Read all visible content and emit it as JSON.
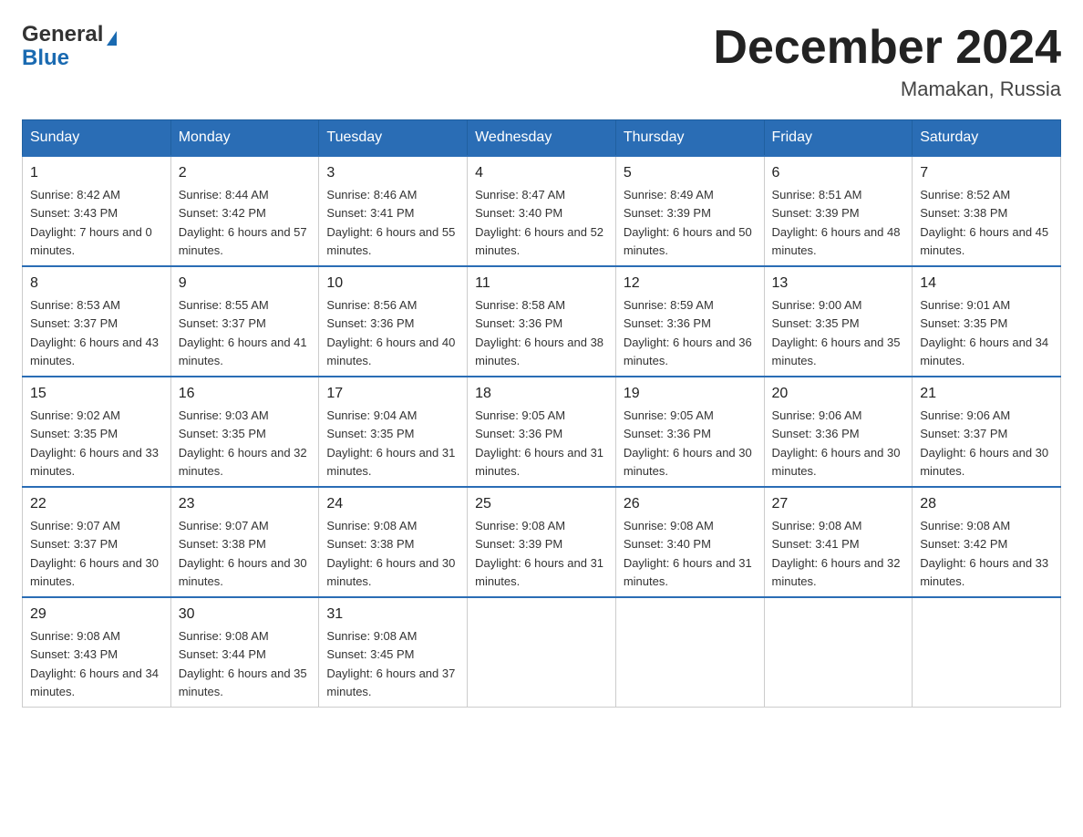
{
  "logo": {
    "general": "General",
    "blue": "Blue",
    "triangle_char": "▶"
  },
  "title": "December 2024",
  "subtitle": "Mamakan, Russia",
  "days_of_week": [
    "Sunday",
    "Monday",
    "Tuesday",
    "Wednesday",
    "Thursday",
    "Friday",
    "Saturday"
  ],
  "weeks": [
    [
      {
        "day": "1",
        "sunrise": "8:42 AM",
        "sunset": "3:43 PM",
        "daylight": "7 hours and 0 minutes."
      },
      {
        "day": "2",
        "sunrise": "8:44 AM",
        "sunset": "3:42 PM",
        "daylight": "6 hours and 57 minutes."
      },
      {
        "day": "3",
        "sunrise": "8:46 AM",
        "sunset": "3:41 PM",
        "daylight": "6 hours and 55 minutes."
      },
      {
        "day": "4",
        "sunrise": "8:47 AM",
        "sunset": "3:40 PM",
        "daylight": "6 hours and 52 minutes."
      },
      {
        "day": "5",
        "sunrise": "8:49 AM",
        "sunset": "3:39 PM",
        "daylight": "6 hours and 50 minutes."
      },
      {
        "day": "6",
        "sunrise": "8:51 AM",
        "sunset": "3:39 PM",
        "daylight": "6 hours and 48 minutes."
      },
      {
        "day": "7",
        "sunrise": "8:52 AM",
        "sunset": "3:38 PM",
        "daylight": "6 hours and 45 minutes."
      }
    ],
    [
      {
        "day": "8",
        "sunrise": "8:53 AM",
        "sunset": "3:37 PM",
        "daylight": "6 hours and 43 minutes."
      },
      {
        "day": "9",
        "sunrise": "8:55 AM",
        "sunset": "3:37 PM",
        "daylight": "6 hours and 41 minutes."
      },
      {
        "day": "10",
        "sunrise": "8:56 AM",
        "sunset": "3:36 PM",
        "daylight": "6 hours and 40 minutes."
      },
      {
        "day": "11",
        "sunrise": "8:58 AM",
        "sunset": "3:36 PM",
        "daylight": "6 hours and 38 minutes."
      },
      {
        "day": "12",
        "sunrise": "8:59 AM",
        "sunset": "3:36 PM",
        "daylight": "6 hours and 36 minutes."
      },
      {
        "day": "13",
        "sunrise": "9:00 AM",
        "sunset": "3:35 PM",
        "daylight": "6 hours and 35 minutes."
      },
      {
        "day": "14",
        "sunrise": "9:01 AM",
        "sunset": "3:35 PM",
        "daylight": "6 hours and 34 minutes."
      }
    ],
    [
      {
        "day": "15",
        "sunrise": "9:02 AM",
        "sunset": "3:35 PM",
        "daylight": "6 hours and 33 minutes."
      },
      {
        "day": "16",
        "sunrise": "9:03 AM",
        "sunset": "3:35 PM",
        "daylight": "6 hours and 32 minutes."
      },
      {
        "day": "17",
        "sunrise": "9:04 AM",
        "sunset": "3:35 PM",
        "daylight": "6 hours and 31 minutes."
      },
      {
        "day": "18",
        "sunrise": "9:05 AM",
        "sunset": "3:36 PM",
        "daylight": "6 hours and 31 minutes."
      },
      {
        "day": "19",
        "sunrise": "9:05 AM",
        "sunset": "3:36 PM",
        "daylight": "6 hours and 30 minutes."
      },
      {
        "day": "20",
        "sunrise": "9:06 AM",
        "sunset": "3:36 PM",
        "daylight": "6 hours and 30 minutes."
      },
      {
        "day": "21",
        "sunrise": "9:06 AM",
        "sunset": "3:37 PM",
        "daylight": "6 hours and 30 minutes."
      }
    ],
    [
      {
        "day": "22",
        "sunrise": "9:07 AM",
        "sunset": "3:37 PM",
        "daylight": "6 hours and 30 minutes."
      },
      {
        "day": "23",
        "sunrise": "9:07 AM",
        "sunset": "3:38 PM",
        "daylight": "6 hours and 30 minutes."
      },
      {
        "day": "24",
        "sunrise": "9:08 AM",
        "sunset": "3:38 PM",
        "daylight": "6 hours and 30 minutes."
      },
      {
        "day": "25",
        "sunrise": "9:08 AM",
        "sunset": "3:39 PM",
        "daylight": "6 hours and 31 minutes."
      },
      {
        "day": "26",
        "sunrise": "9:08 AM",
        "sunset": "3:40 PM",
        "daylight": "6 hours and 31 minutes."
      },
      {
        "day": "27",
        "sunrise": "9:08 AM",
        "sunset": "3:41 PM",
        "daylight": "6 hours and 32 minutes."
      },
      {
        "day": "28",
        "sunrise": "9:08 AM",
        "sunset": "3:42 PM",
        "daylight": "6 hours and 33 minutes."
      }
    ],
    [
      {
        "day": "29",
        "sunrise": "9:08 AM",
        "sunset": "3:43 PM",
        "daylight": "6 hours and 34 minutes."
      },
      {
        "day": "30",
        "sunrise": "9:08 AM",
        "sunset": "3:44 PM",
        "daylight": "6 hours and 35 minutes."
      },
      {
        "day": "31",
        "sunrise": "9:08 AM",
        "sunset": "3:45 PM",
        "daylight": "6 hours and 37 minutes."
      },
      null,
      null,
      null,
      null
    ]
  ],
  "labels": {
    "sunrise": "Sunrise:",
    "sunset": "Sunset:",
    "daylight": "Daylight:"
  }
}
